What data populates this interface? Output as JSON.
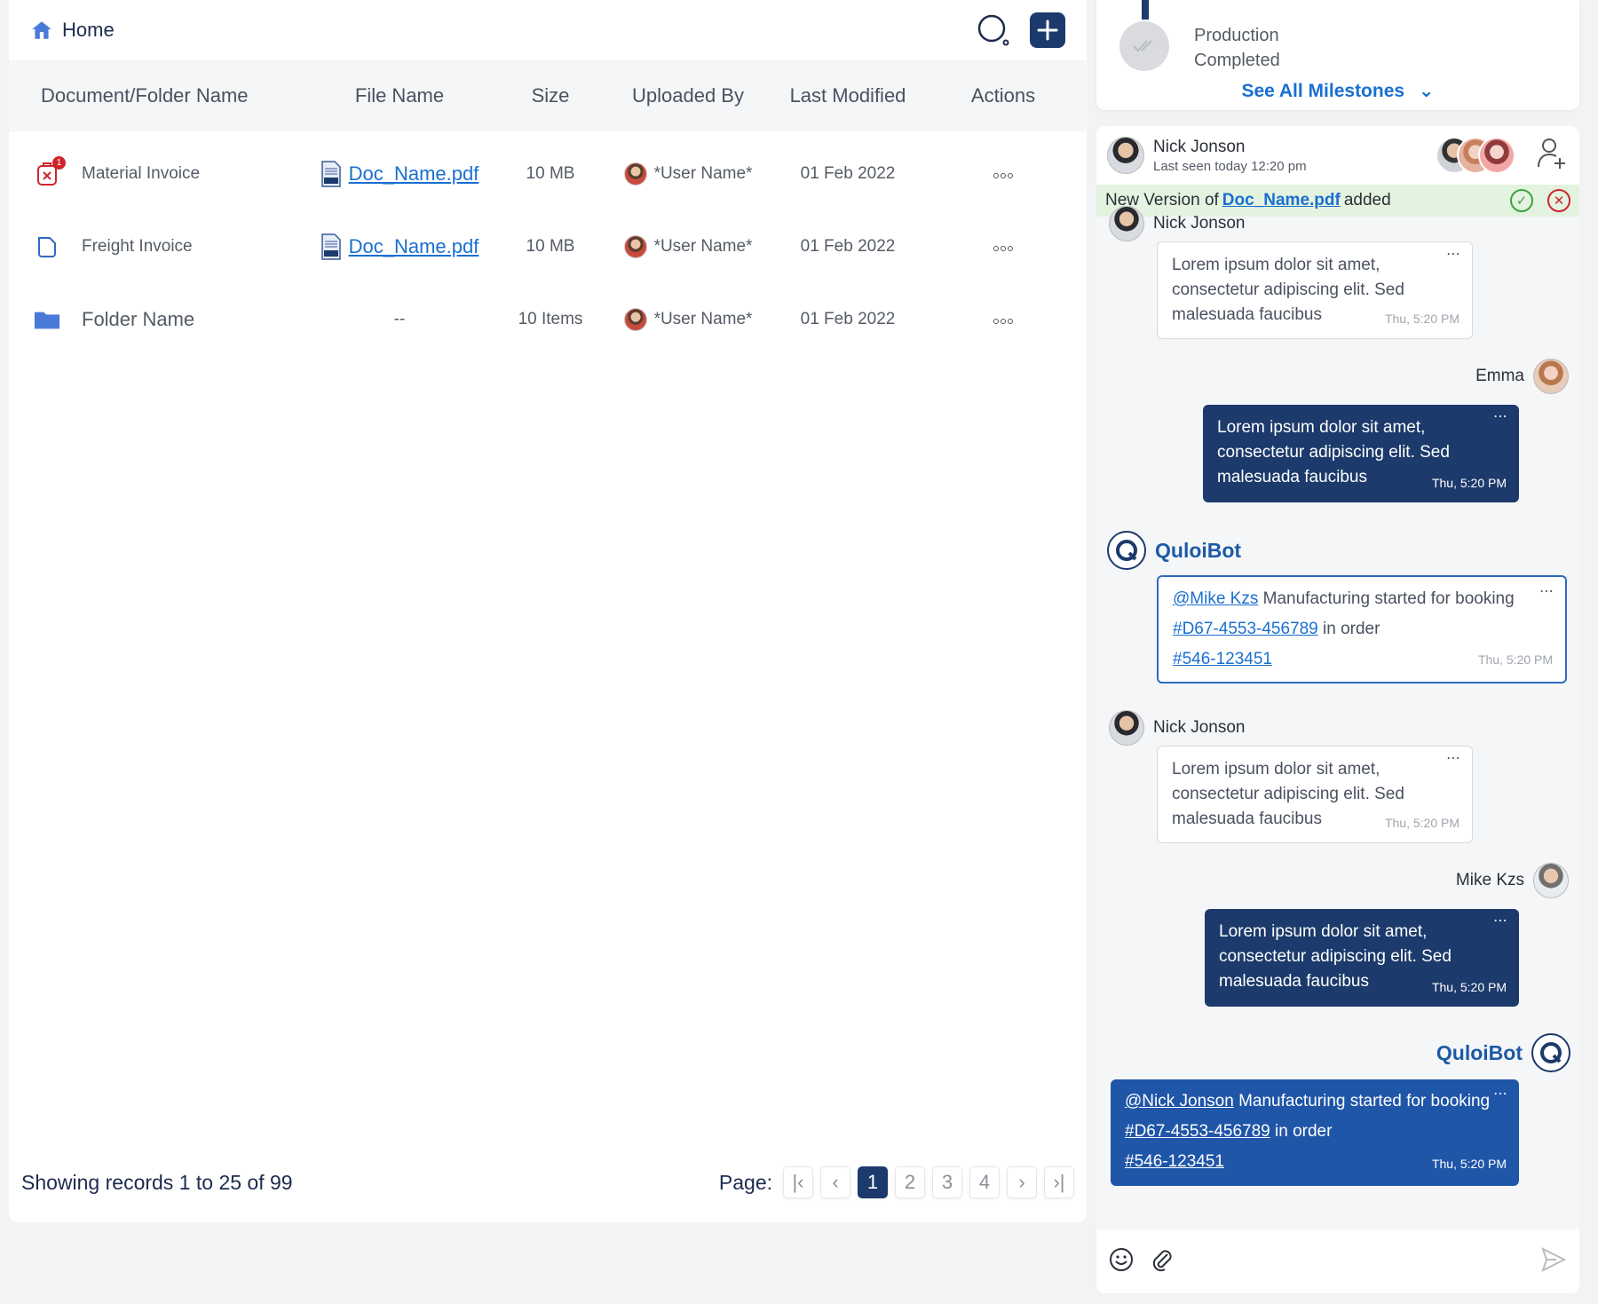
{
  "header": {
    "home_label": "Home"
  },
  "table": {
    "columns": [
      "Document/Folder Name",
      "File Name",
      "Size",
      "Uploaded By",
      "Last Modified",
      "Actions"
    ],
    "rows": [
      {
        "name": "Material Invoice",
        "file": "Doc_Name.pdf",
        "size": "10 MB",
        "uploader": "*User Name*",
        "modified": "01 Feb 2022",
        "badge": "1"
      },
      {
        "name": "Freight Invoice",
        "file": "Doc_Name.pdf",
        "size": "10 MB",
        "uploader": "*User Name*",
        "modified": "01 Feb 2022"
      },
      {
        "name": "Folder Name",
        "file": "--",
        "size": "10 Items",
        "uploader": "*User Name*",
        "modified": "01 Feb 2022"
      }
    ]
  },
  "footer": {
    "records": "Showing records 1 to 25 of 99",
    "page_label": "Page:",
    "pages": [
      "1",
      "2",
      "3",
      "4"
    ],
    "current_page": "1"
  },
  "milestone": {
    "status_line1": "Production",
    "status_line2": "Completed",
    "see_all": "See All Milestones"
  },
  "chat": {
    "header": {
      "name": "Nick Jonson",
      "last_seen": "Last seen today 12:20 pm"
    },
    "notice": {
      "prefix": "New Version of",
      "file": "Doc_Name.pdf",
      "suffix": "added"
    },
    "messages": [
      {
        "sender": "Nick Jonson",
        "text": "Lorem ipsum dolor sit amet, consectetur adipiscing elit. Sed malesuada faucibus",
        "time": "Thu, 5:20 PM"
      },
      {
        "sender": "Emma",
        "text": "Lorem ipsum dolor sit amet, consectetur adipiscing elit. Sed malesuada faucibus",
        "time": "Thu, 5:20 PM"
      },
      {
        "sender": "QuloiBot",
        "mention": "@Mike Kzs",
        "text1": "Manufacturing started for booking",
        "booking": "#D67-4553-456789",
        "text2": "in order",
        "order": "#546-123451",
        "time": "Thu, 5:20 PM"
      },
      {
        "sender": "Nick Jonson",
        "text": "Lorem ipsum dolor sit amet, consectetur adipiscing elit. Sed malesuada faucibus",
        "time": "Thu, 5:20 PM"
      },
      {
        "sender": "Mike Kzs",
        "text": "Lorem ipsum dolor sit amet, consectetur adipiscing elit. Sed malesuada faucibus",
        "time": "Thu, 5:20 PM"
      },
      {
        "sender": "QuloiBot",
        "mention": "@Nick Jonson",
        "text1": "Manufacturing started for booking",
        "booking": "#D67-4553-456789",
        "text2": "in order",
        "order": "#546-123451",
        "time": "Thu, 5:20 PM"
      }
    ]
  },
  "colors": {
    "primary": "#1c3a6b",
    "link": "#1a6fd0",
    "bot_blue": "#2056a8",
    "notice_bg": "#e3f3df",
    "badge_red": "#d0242d"
  }
}
